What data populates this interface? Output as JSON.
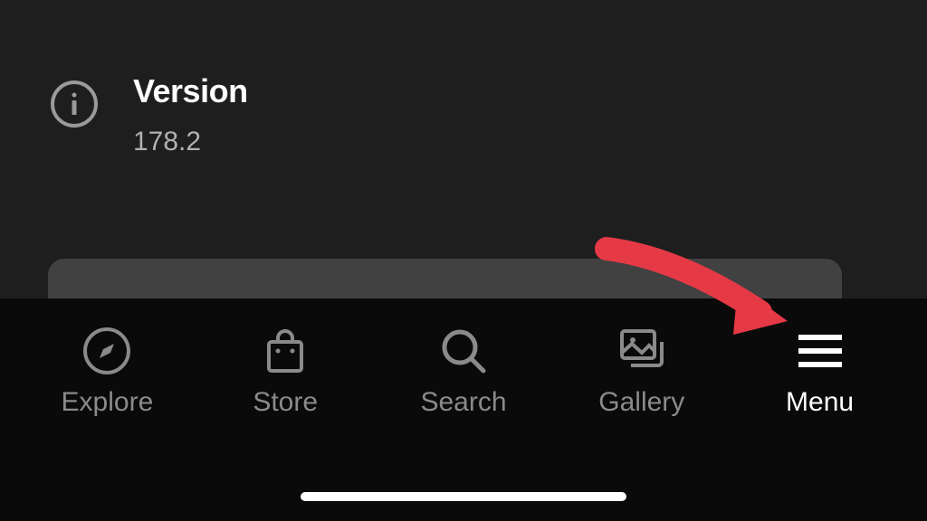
{
  "version": {
    "label": "Version",
    "number": "178.2"
  },
  "nav": {
    "items": [
      {
        "label": "Explore"
      },
      {
        "label": "Store"
      },
      {
        "label": "Search"
      },
      {
        "label": "Gallery"
      },
      {
        "label": "Menu"
      }
    ]
  }
}
